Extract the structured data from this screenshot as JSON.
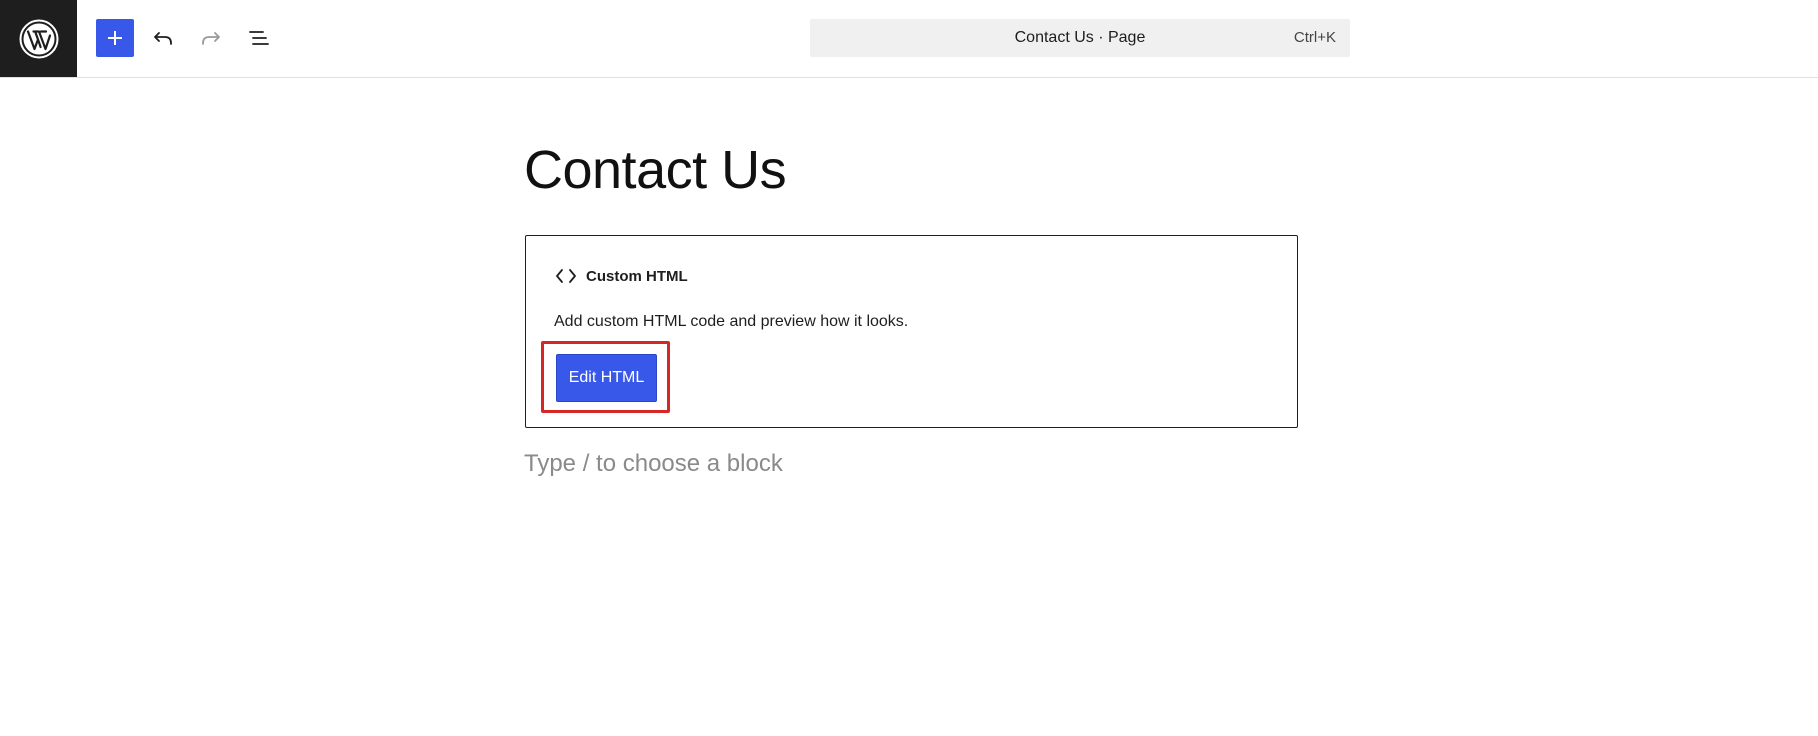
{
  "toolbar": {
    "logo_icon": "wordpress-logo-icon",
    "add_block_icon": "plus-icon",
    "undo_icon": "undo-icon",
    "redo_icon": "redo-icon",
    "list_view_icon": "list-view-icon",
    "command_bar_text": "Contact Us · Page",
    "command_bar_shortcut": "Ctrl+K"
  },
  "editor": {
    "page_title": "Contact Us",
    "custom_html_block": {
      "icon": "code-icon",
      "label": "Custom HTML",
      "description": "Add custom HTML code and preview how it looks.",
      "edit_button_label": "Edit HTML"
    },
    "appender_placeholder": "Type / to choose a block"
  },
  "colors": {
    "accent": "#3858e9",
    "dark": "#1e1e1e",
    "highlight": "#d62728"
  }
}
